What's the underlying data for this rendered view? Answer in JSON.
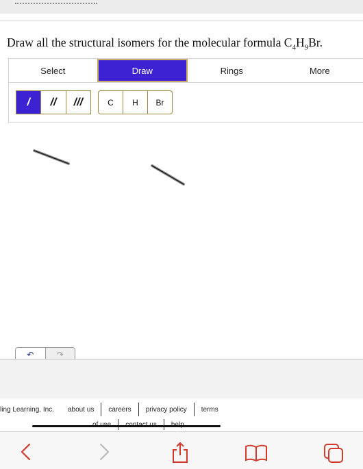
{
  "question": {
    "prefix": "Draw all the structural isomers for the molecular formula C",
    "c_sub": "4",
    "h": "H",
    "h_sub": "9",
    "suffix": "Br."
  },
  "tabs": [
    {
      "label": "Select"
    },
    {
      "label": "Draw"
    },
    {
      "label": "Rings"
    },
    {
      "label": "More"
    }
  ],
  "active_tab": "Draw",
  "bonds": [
    {
      "label": "/"
    },
    {
      "label": "//"
    },
    {
      "label": "///"
    }
  ],
  "atoms": [
    {
      "label": "C"
    },
    {
      "label": "H"
    },
    {
      "label": "Br"
    }
  ],
  "footer": {
    "row1": [
      "ling Learning, Inc.",
      "about us",
      "careers",
      "privacy policy",
      "terms"
    ],
    "row2": [
      "of use",
      "contact us",
      "help"
    ]
  },
  "colors": {
    "accent": "#3d22d4",
    "accent_border": "#caa96a",
    "tool_border": "#9b8a40",
    "browser_icon": "#d23a2c"
  },
  "icons": [
    "undo-icon",
    "redo-icon",
    "back-icon",
    "forward-icon",
    "share-icon",
    "bookmarks-icon",
    "tabs-icon"
  ]
}
